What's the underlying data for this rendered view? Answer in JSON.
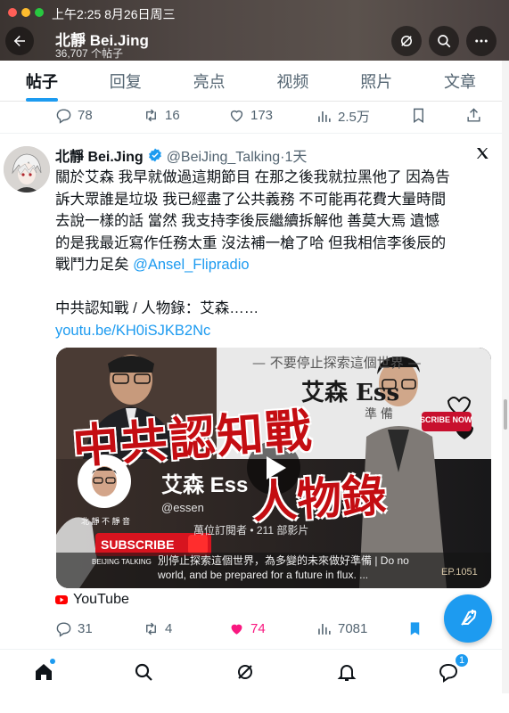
{
  "status": {
    "time": "上午2:25   8月26日周三"
  },
  "header": {
    "name": "北靜 Bei.Jing",
    "post_count": "36,707 个帖子"
  },
  "tabs": [
    "帖子",
    "回复",
    "亮点",
    "视频",
    "照片",
    "文章"
  ],
  "prev_tweet": {
    "replies": "78",
    "reposts": "16",
    "likes": "173",
    "views": "2.5万"
  },
  "tweet": {
    "name": "北靜 Bei.Jing",
    "handle": "@BeiJing_Talking·1天",
    "body_lines": [
      "關於艾森 我早就做過這期節目 在那之後我就拉黑他了 因為告",
      "訴大眾誰是垃圾 我已經盡了公共義務 不可能再花費大量時間",
      "去說一樣的話 當然 我支持李後辰繼續拆解他 善莫大焉 遺憾",
      "的是我最近寫作任務太重 沒法補一槍了哈 但我相信李後辰的",
      "戰鬥力足矣 "
    ],
    "mention": "@Ansel_Flipradio",
    "line2": "中共認知戰 / 人物錄：艾森……",
    "link": "youtu.be/KH0iSJKB2Nc",
    "media": {
      "title_big": "中共認知戰",
      "title_sub": "人物錄",
      "top_caption": "— 不要停止探索這個世界 —",
      "channel_name": "艾森 Ess",
      "handle": "@essen",
      "subs": "萬位訂閱者 • 211 部影片",
      "desc": "別停止探索這個世界，為多變的未來做好準備 | Do no",
      "desc2": "world, and be prepared for a future in flux. ...",
      "badge": "EP.1051",
      "subscribe": "SUBSCRIBE",
      "watermark_top": "北 靜  不 靜 音",
      "watermark_bottom": "BEIJING TALKING",
      "side_text": "艾森 Ess",
      "side_text2": "準 備",
      "sub_badge": "SCRIBE NOW"
    },
    "source": "YouTube",
    "replies": "31",
    "reposts": "4",
    "likes": "74",
    "views": "7081"
  },
  "nav": {
    "messages_badge": "1"
  },
  "colors": {
    "accent": "#1d9bf0",
    "like": "#f91880",
    "youtube": "#ff0000"
  }
}
